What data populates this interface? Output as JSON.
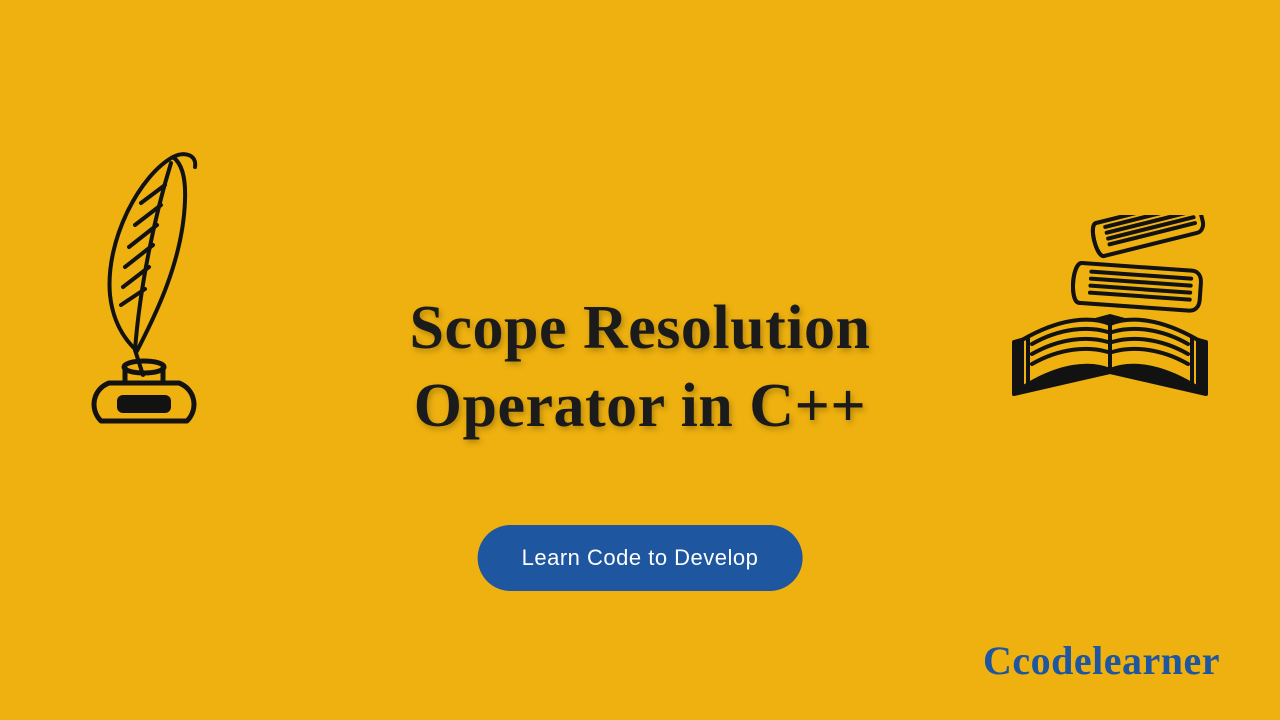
{
  "title_line1": "Scope Resolution",
  "title_line2": "Operator in C++",
  "cta_label": "Learn Code to Develop",
  "brand": "Ccodelearner",
  "colors": {
    "background": "#EEB10F",
    "accent": "#1E56A0",
    "text": "#1b1b1b"
  },
  "icons": {
    "left": "quill-inkwell-icon",
    "right": "books-stack-icon"
  }
}
